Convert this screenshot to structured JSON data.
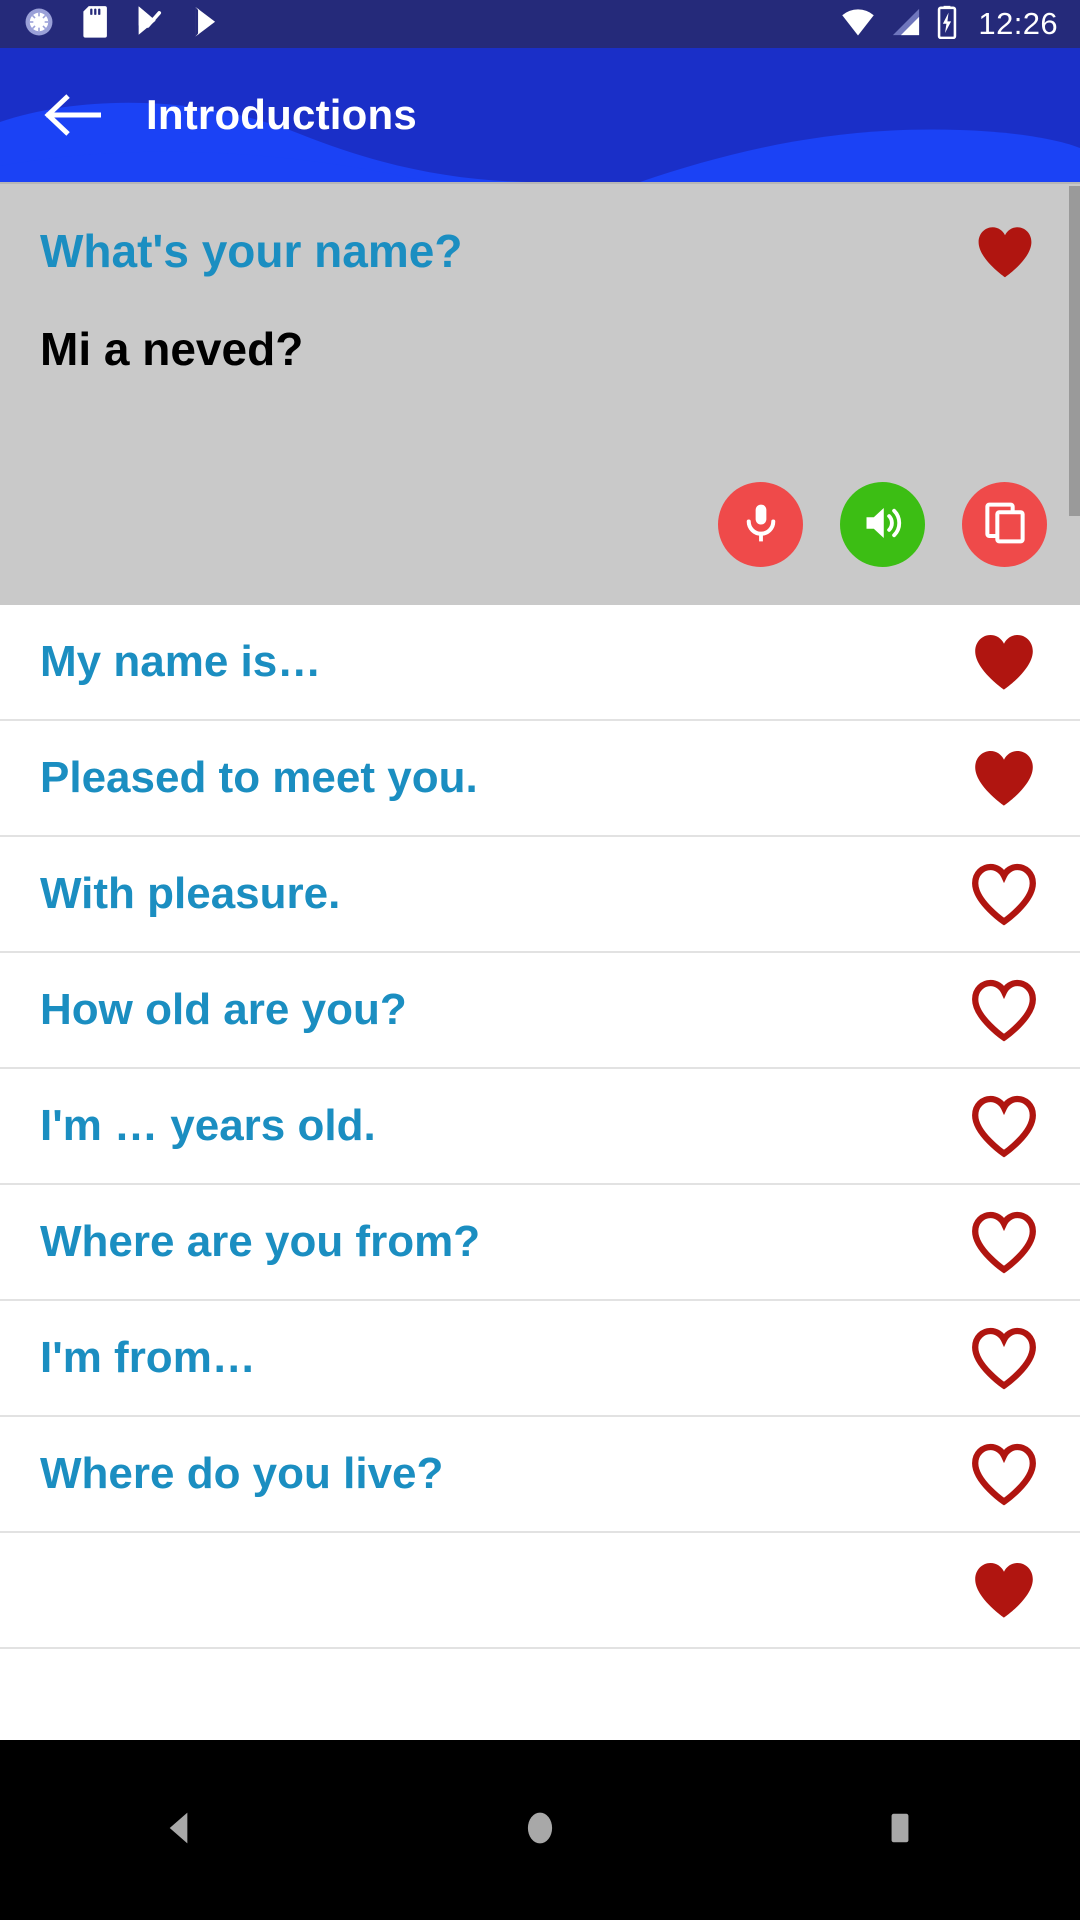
{
  "status_bar": {
    "time": "12:26",
    "left_icons": [
      "sync-icon",
      "sd-card-icon",
      "play-store-check-icon",
      "play-store-icon"
    ],
    "right_icons": [
      "wifi-icon",
      "cellular-signal-icon",
      "battery-charging-icon"
    ],
    "background_color": "#252a7a"
  },
  "app_bar": {
    "title": "Introductions",
    "back_icon": "back-arrow-icon",
    "background_color": "#1a2fc8",
    "wave_color": "#1b42f5"
  },
  "header_card": {
    "phrase": "What's your name?",
    "translation": "Mi a neved?",
    "favorite": true,
    "favorite_icon": "heart-filled-icon",
    "background_color": "#c9c9c9",
    "phrase_color": "#1b8ec1",
    "translation_color": "#000000",
    "actions": [
      {
        "name": "record-button",
        "icon": "microphone-icon",
        "color": "#ef4a4a"
      },
      {
        "name": "speak-button",
        "icon": "speaker-volume-icon",
        "color": "#3cbe14"
      },
      {
        "name": "copy-button",
        "icon": "copy-icon",
        "color": "#ef4a4a"
      }
    ],
    "scrollbar_visible": true
  },
  "list": {
    "text_color": "#1b8ec1",
    "heart_color": "#b01510",
    "items": [
      {
        "label": "My name is…",
        "favorite": true
      },
      {
        "label": "Pleased to meet you.",
        "favorite": true
      },
      {
        "label": "With pleasure.",
        "favorite": false
      },
      {
        "label": "How old are you?",
        "favorite": false
      },
      {
        "label": "I'm … years old.",
        "favorite": false
      },
      {
        "label": "Where are you from?",
        "favorite": false
      },
      {
        "label": "I'm from…",
        "favorite": false
      },
      {
        "label": "Where do you live?",
        "favorite": false
      },
      {
        "label": "",
        "favorite": true
      }
    ]
  },
  "nav_bar": {
    "background_color": "#000000",
    "buttons": [
      {
        "name": "nav-back-button",
        "icon": "triangle-back-icon"
      },
      {
        "name": "nav-home-button",
        "icon": "circle-home-icon"
      },
      {
        "name": "nav-recents-button",
        "icon": "square-recents-icon"
      }
    ]
  }
}
